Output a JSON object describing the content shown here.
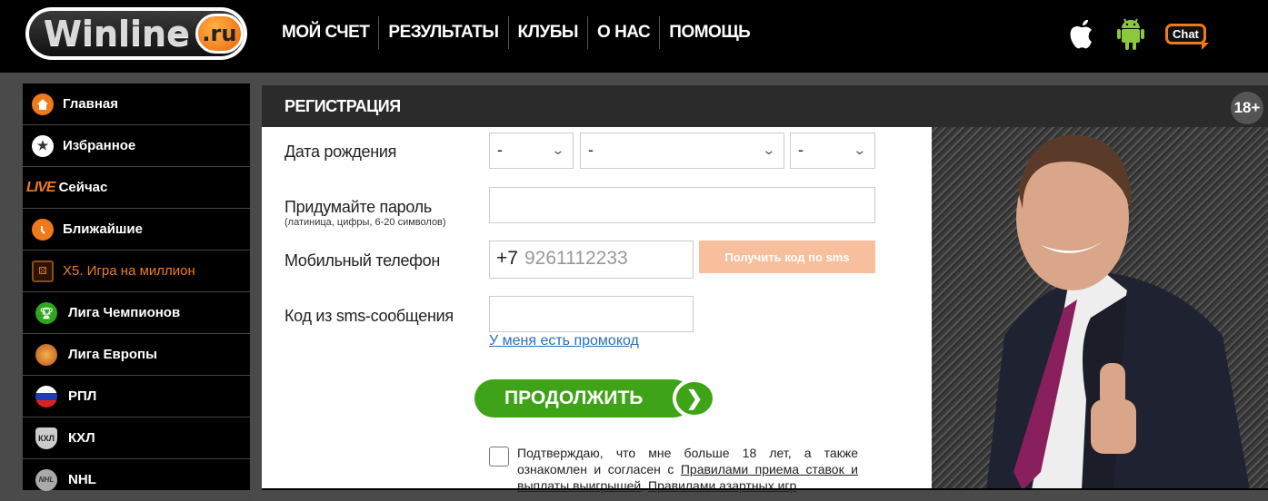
{
  "header": {
    "logo_word": "Winline",
    "logo_tld": ".ru",
    "nav": [
      "МОЙ СЧЕТ",
      "РЕЗУЛЬТАТЫ",
      "КЛУБЫ",
      "О НАС",
      "ПОМОЩЬ"
    ],
    "icons": [
      "apple-icon",
      "android-icon",
      "chat-icon"
    ],
    "chat_label": "Chat"
  },
  "sidebar": {
    "items": [
      {
        "label": "Главная",
        "icon": "home-icon"
      },
      {
        "label": "Избранное",
        "icon": "star-icon"
      },
      {
        "label": "Сейчас",
        "icon": "live-icon",
        "badge": "LIVE"
      },
      {
        "label": "Ближайшие",
        "icon": "clock-icon"
      },
      {
        "label": "X5. Игра на миллион",
        "icon": "dice-icon"
      },
      {
        "label": "Лига Чемпионов",
        "icon": "trophy-icon"
      },
      {
        "label": "Лига Европы",
        "icon": "europa-league-icon"
      },
      {
        "label": "РПЛ",
        "icon": "russia-flag-icon"
      },
      {
        "label": "КХЛ",
        "icon": "khl-icon"
      },
      {
        "label": "NHL",
        "icon": "nhl-icon"
      }
    ]
  },
  "panel": {
    "title": "РЕГИСТРАЦИЯ",
    "age_badge": "18+"
  },
  "form": {
    "birth_label": "Дата рождения",
    "birth_day": "-",
    "birth_month": "-",
    "birth_year": "-",
    "password_label": "Придумайте пароль",
    "password_hint": "(латиница, цифры, 6-20 символов)",
    "password_value": "",
    "phone_label": "Мобильный телефон",
    "phone_prefix": "+7",
    "phone_placeholder": "9261112233",
    "sms_button": "Получить код по sms",
    "sms_code_label": "Код из sms-сообщения",
    "sms_code_value": "",
    "promo_link": "У меня есть промокод",
    "continue_button": "ПРОДОЛЖИТЬ",
    "agree_text_1": "Подтверждаю, что мне больше 18 лет, а также ознакомлен и согласен с ",
    "agree_link_1": "Правилами приема ставок и выплаты выигрышей",
    "agree_text_2": ", ",
    "agree_link_2": "Правилами азартных игр",
    "agree_checked": false
  },
  "colors": {
    "accent_orange": "#f07a1a",
    "continue_green": "#3fa318",
    "sms_button_bg": "#f7bf9c",
    "link_blue": "#2a6ebb"
  }
}
